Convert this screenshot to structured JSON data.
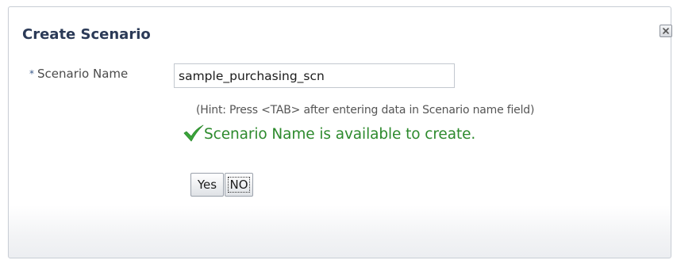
{
  "dialog": {
    "title": "Create Scenario",
    "close_icon": "close-icon"
  },
  "form": {
    "required_marker": "*",
    "scenario_name_label": "Scenario Name",
    "scenario_name_value": "sample_purchasing_scn",
    "hint": "(Hint: Press <TAB> after entering data in Scenario name field)",
    "availability_icon": "checkmark-icon",
    "availability_message": "Scenario Name is available to create."
  },
  "buttons": {
    "yes_label": "Yes",
    "no_label": "NO"
  },
  "colors": {
    "title": "#2b3a57",
    "success": "#2d8a2d",
    "check": "#3aa53a"
  }
}
